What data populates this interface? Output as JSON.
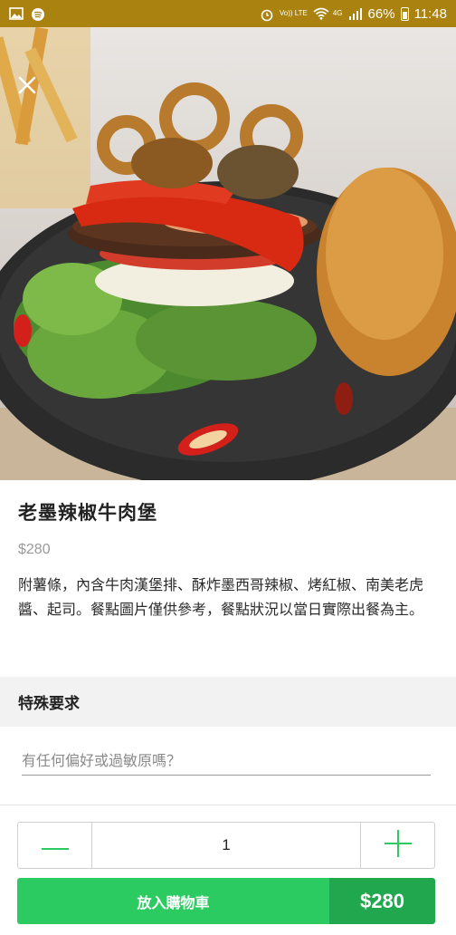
{
  "status_bar": {
    "volte": "Vo)) LTE",
    "network": "4G",
    "battery": "66%",
    "time": "11:48"
  },
  "product": {
    "name": "老墨辣椒牛肉堡",
    "price": "$280",
    "description": "附薯條，內含牛肉漢堡排、酥炸墨西哥辣椒、烤紅椒、南美老虎醬、起司。餐點圖片僅供參考，餐點狀況以當日實際出餐為主。"
  },
  "special_request": {
    "heading": "特殊要求",
    "placeholder": "有任何偏好或過敏原嗎？"
  },
  "quantity": {
    "value": "1"
  },
  "cart": {
    "label": "放入購物車",
    "total": "$280"
  },
  "colors": {
    "status_bar": "#a9820f",
    "accent_green": "#2ccb62",
    "accent_green_dark": "#21a84e"
  },
  "icons": [
    "gallery-icon",
    "spotify-icon",
    "alarm-icon",
    "wifi-icon",
    "signal-icon",
    "battery-icon",
    "close-icon",
    "minus-icon",
    "plus-icon"
  ]
}
